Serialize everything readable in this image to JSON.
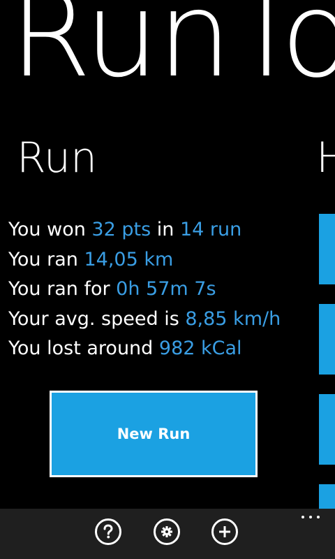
{
  "app": {
    "title": "RunTo"
  },
  "sections": {
    "current": "Run",
    "next_peek": "H"
  },
  "stats": [
    {
      "prefix": "You won ",
      "value1": "32 pts",
      "middle": " in ",
      "value2": "14 run"
    },
    {
      "prefix": "You ran ",
      "value1": "14,05 km",
      "middle": "",
      "value2": ""
    },
    {
      "prefix": "You ran for ",
      "value1": "0h 57m 7s",
      "middle": "",
      "value2": ""
    },
    {
      "prefix": "Your avg. speed is ",
      "value1": "8,85 km/h",
      "middle": "",
      "value2": ""
    },
    {
      "prefix": "You lost around ",
      "value1": "982 kCal",
      "middle": "",
      "value2": ""
    }
  ],
  "actions": {
    "new_run_label": "New Run"
  },
  "app_bar": {
    "buttons": [
      {
        "icon": "help-icon"
      },
      {
        "icon": "gear-icon"
      },
      {
        "icon": "add-icon"
      }
    ],
    "more": "more-dots-icon"
  },
  "colors": {
    "background": "#000000",
    "accent": "#1ba1e2",
    "accent_text": "#3a9ee4",
    "app_bar": "#1f1f1f",
    "text": "#ffffff"
  }
}
